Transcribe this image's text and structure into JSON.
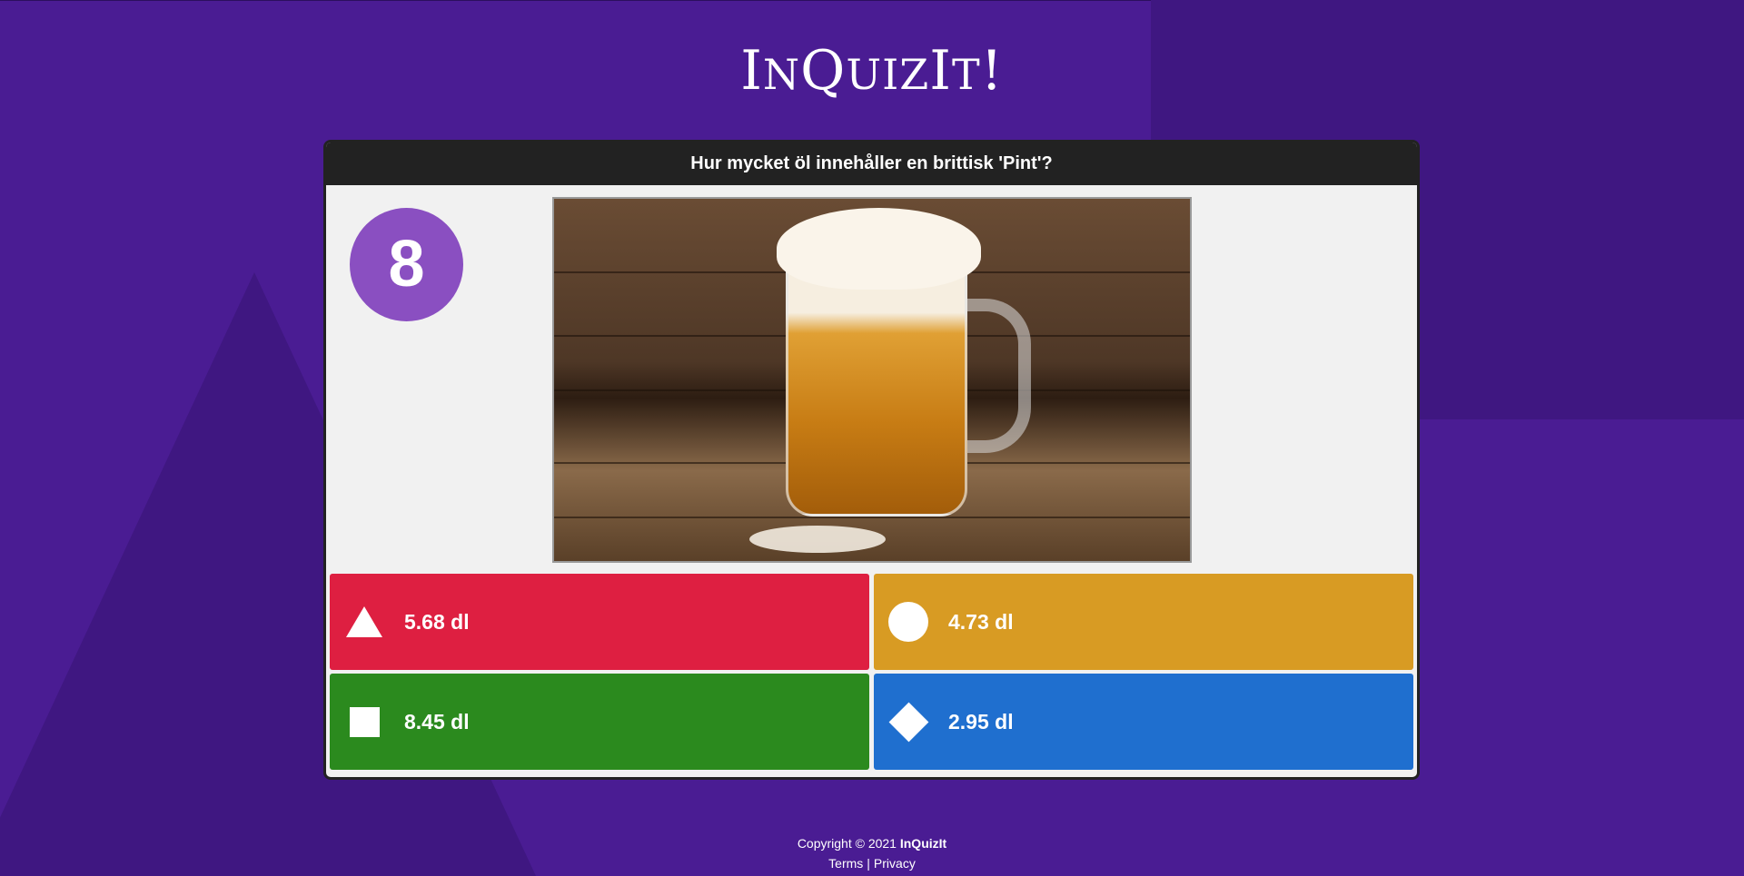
{
  "brand": {
    "title_big_1": "I",
    "title_small_1": "N",
    "title_big_2": "Q",
    "title_small_2": "UIZ",
    "title_big_3": "I",
    "title_small_3": "T",
    "title_end": "!"
  },
  "question": {
    "text": "Hur mycket öl innehåller en brittisk 'Pint'?",
    "timer": "8",
    "image_alt": "beer-mug-photo"
  },
  "answers": [
    {
      "label": "5.68 dl",
      "shape": "triangle-icon",
      "color": "#de1f41"
    },
    {
      "label": "4.73 dl",
      "shape": "circle-icon",
      "color": "#d89b23"
    },
    {
      "label": "8.45 dl",
      "shape": "square-icon",
      "color": "#2b8a1e"
    },
    {
      "label": "2.95 dl",
      "shape": "diamond-icon",
      "color": "#1f6fcf"
    }
  ],
  "footer": {
    "copyright_prefix": "Copyright © 2021 ",
    "copyright_brand": "InQuizIt",
    "terms": "Terms",
    "separator": "|",
    "privacy": "Privacy"
  },
  "colors": {
    "background": "#4a1c93",
    "question_bar": "#222222",
    "timer_circle": "#8a4fc1"
  }
}
